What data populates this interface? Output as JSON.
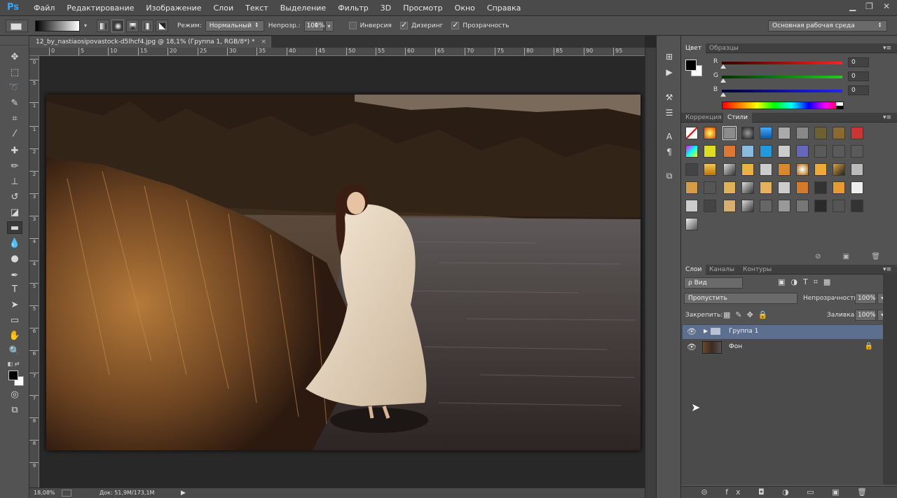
{
  "app": {
    "logo": "Ps"
  },
  "menu": [
    "Файл",
    "Редактирование",
    "Изображение",
    "Слои",
    "Текст",
    "Выделение",
    "Фильтр",
    "3D",
    "Просмотр",
    "Окно",
    "Справка"
  ],
  "window_controls": {
    "minimize": "▁",
    "restore": "❐",
    "close": "✕"
  },
  "options_bar": {
    "mode_label": "Режим:",
    "mode_value": "Нормальный",
    "opacity_label": "Непрозр.:",
    "opacity_value": "100%",
    "inversion_label": "Инверсия",
    "dither_label": "Дизеринг",
    "transparency_label": "Прозрачность",
    "inversion_checked": false,
    "dither_checked": true,
    "transparency_checked": true,
    "workspace": "Основная рабочая среда"
  },
  "document": {
    "tab_title": "12_by_nastiaosipovastock-d5lhcf4.jpg @ 18,1% (Группа 1, RGB/8*) *",
    "close": "×"
  },
  "ruler_top": [
    "0",
    "5",
    "10",
    "15",
    "20",
    "25",
    "30",
    "35",
    "40",
    "45",
    "50",
    "55",
    "60",
    "65",
    "70",
    "75",
    "80",
    "85",
    "90",
    "95"
  ],
  "ruler_left": [
    "0",
    "5",
    "1",
    "1",
    "2",
    "2",
    "3",
    "3",
    "4",
    "4",
    "5",
    "5",
    "6",
    "6",
    "7",
    "7",
    "8",
    "8",
    "9"
  ],
  "status": {
    "zoom": "18,08%",
    "doc": "Док: 51,9M/173,1M",
    "arrow": "▶"
  },
  "color_panel": {
    "tabs": [
      "Цвет",
      "Образцы"
    ],
    "active_tab": "Цвет",
    "channels": [
      {
        "label": "R",
        "value": "0",
        "color": "#ff2020"
      },
      {
        "label": "G",
        "value": "0",
        "color": "#20c020"
      },
      {
        "label": "B",
        "value": "0",
        "color": "#2020ff"
      }
    ]
  },
  "styles_panel": {
    "tabs": [
      "Коррекция",
      "Стили"
    ],
    "active_tab": "Стили"
  },
  "layers_panel": {
    "tabs": [
      "Слои",
      "Каналы",
      "Контуры"
    ],
    "active_tab": "Слои",
    "filter_kind": "ρ Вид",
    "blend_mode": "Пропустить",
    "opacity_label": "Непрозрачность:",
    "opacity_value": "100%",
    "lock_label": "Закрепить:",
    "fill_label": "Заливка:",
    "fill_value": "100%",
    "layers": [
      {
        "name": "Группа 1",
        "type": "group",
        "selected": true
      },
      {
        "name": "Фон",
        "type": "image",
        "selected": false,
        "locked": true
      }
    ],
    "bottom_icons": "⊝ fx ◘ ◑ ▭ ▣ 🗑"
  },
  "colors": {
    "accent_selected_layer": "#5c6f8e",
    "ps_blue": "#31a8ff"
  }
}
